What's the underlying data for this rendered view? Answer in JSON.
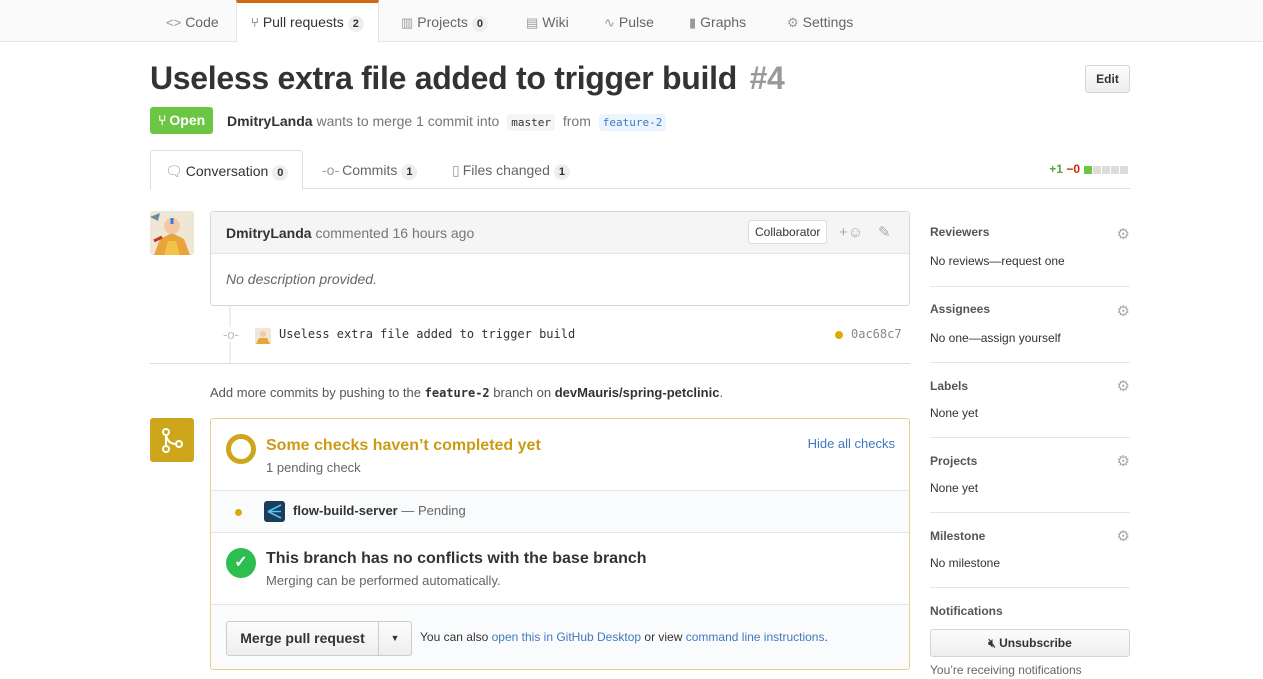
{
  "repo_nav": {
    "tabs": [
      {
        "label": "Code",
        "icon": "code-icon"
      },
      {
        "label": "Pull requests",
        "count": "2",
        "icon": "pull-request-icon"
      },
      {
        "label": "Projects",
        "count": "0",
        "icon": "project-icon"
      },
      {
        "label": "Wiki",
        "icon": "book-icon"
      },
      {
        "label": "Pulse",
        "icon": "pulse-icon"
      },
      {
        "label": "Graphs",
        "icon": "graph-icon"
      },
      {
        "label": "Settings",
        "icon": "gear-icon"
      }
    ]
  },
  "pr": {
    "title": "Useless extra file added to trigger build",
    "number": "#4",
    "edit_label": "Edit",
    "state": "Open",
    "author": "DmitryLanda",
    "meta_text": "wants to merge 1 commit into",
    "base_branch": "master",
    "from_text": "from",
    "head_branch": "feature-2"
  },
  "tabs": {
    "conversation": {
      "label": "Conversation",
      "count": "0"
    },
    "commits": {
      "label": "Commits",
      "count": "1"
    },
    "files": {
      "label": "Files changed",
      "count": "1"
    },
    "diffstat": {
      "additions": "+1",
      "deletions": "−0"
    }
  },
  "comment": {
    "author": "DmitryLanda",
    "action": "commented 16 hours ago",
    "badge": "Collaborator",
    "body": "No description provided."
  },
  "commit": {
    "message": "Useless extra file added to trigger build",
    "sha": "0ac68c7"
  },
  "push_note": {
    "prefix": "Add more commits by pushing to the",
    "branch": "feature-2",
    "middle": "branch on",
    "repo": "devMauris/spring-petclinic",
    "suffix": "."
  },
  "merge_box": {
    "checks_title": "Some checks haven’t completed yet",
    "checks_sub": "1 pending check",
    "hide_checks": "Hide all checks",
    "check_name": "flow-build-server",
    "check_status": "— Pending",
    "noconflict_title": "This branch has no conflicts with the base branch",
    "noconflict_sub": "Merging can be performed automatically.",
    "merge_button": "Merge pull request",
    "alt_prefix": "You can also",
    "alt_link1": "open this in GitHub Desktop",
    "alt_middle": "or view",
    "alt_link2": "command line instructions",
    "alt_suffix": "."
  },
  "sidebar": {
    "reviewers": {
      "heading": "Reviewers",
      "value": "No reviews—request one"
    },
    "assignees": {
      "heading": "Assignees",
      "value": "No one—assign yourself"
    },
    "labels": {
      "heading": "Labels",
      "value": "None yet"
    },
    "projects": {
      "heading": "Projects",
      "value": "None yet"
    },
    "milestone": {
      "heading": "Milestone",
      "value": "No milestone"
    },
    "notifications": {
      "heading": "Notifications",
      "unsubscribe": "Unsubscribe",
      "note": "You’re receiving notifications"
    }
  },
  "colors": {
    "open_green": "#6cc644",
    "pending_yellow": "#cea61b",
    "link_blue": "#4078c0",
    "success_green": "#2cbe4e"
  }
}
